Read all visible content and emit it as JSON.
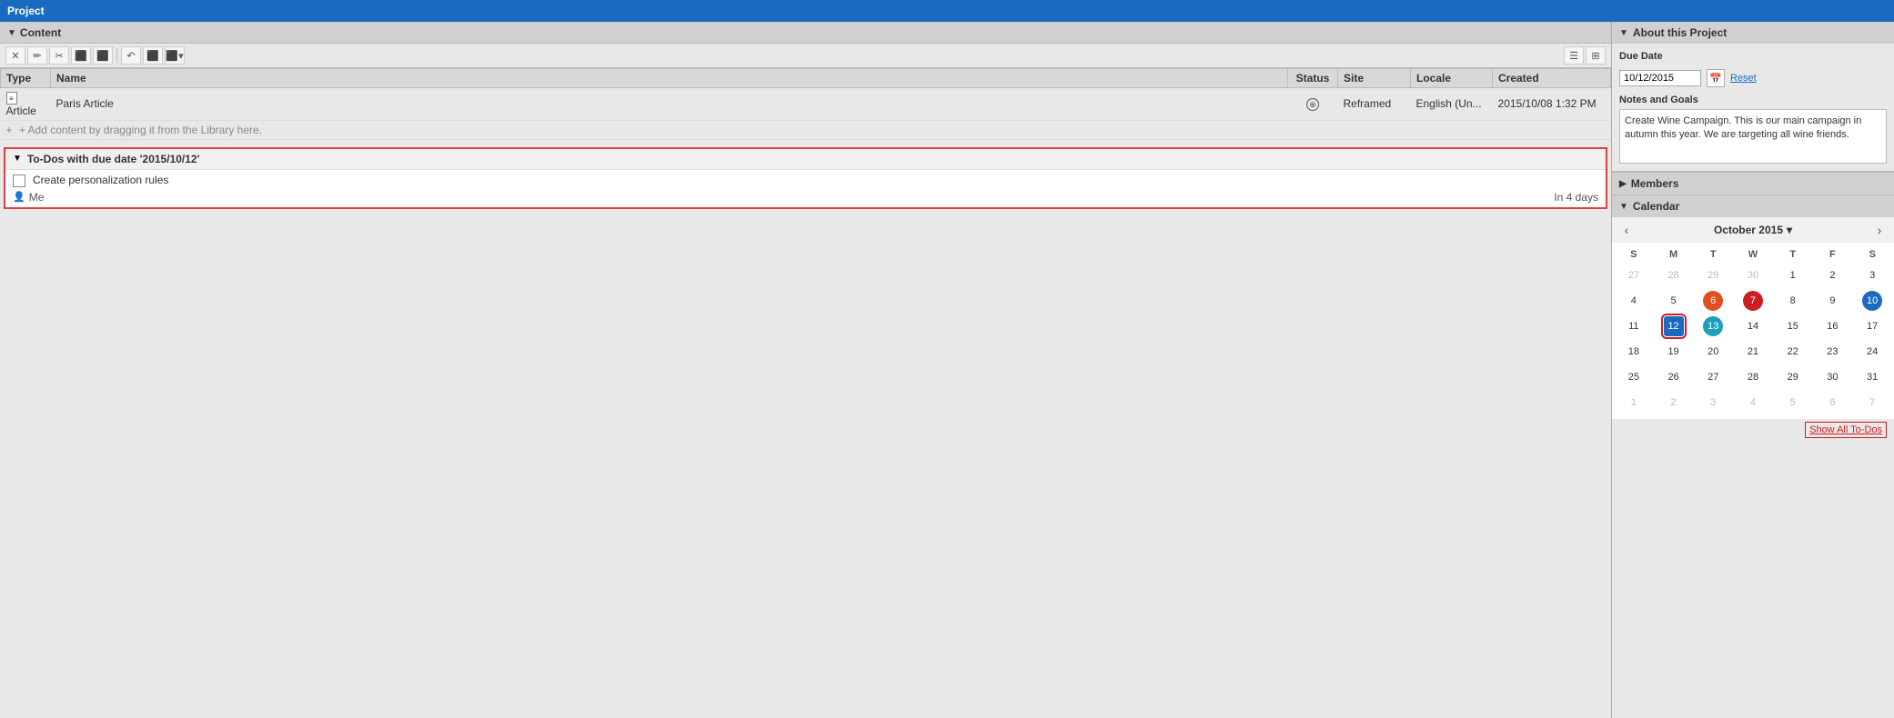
{
  "titleBar": {
    "label": "Project"
  },
  "toolbar": {
    "buttons": [
      "✕",
      "✏",
      "✂",
      "⬛",
      "⬛",
      "↶",
      "⬛",
      "⬛"
    ],
    "viewIcons": [
      "☰",
      "⊞"
    ]
  },
  "contentSection": {
    "toggle": "▼",
    "label": "Content",
    "table": {
      "columns": [
        "Type",
        "Name",
        "Status",
        "Site",
        "Locale",
        "Created"
      ],
      "rows": [
        {
          "type": "Article",
          "name": "Paris Article",
          "status": "globe",
          "site": "Reframed",
          "locale": "English (Un...",
          "created": "2015/10/08 1:32 PM"
        }
      ],
      "addRow": "+ Add content by dragging it from the Library here."
    }
  },
  "todoSection": {
    "toggle": "▼",
    "label": "To-Dos with due date '2015/10/12'",
    "items": [
      {
        "checked": false,
        "label": "Create personalization rules",
        "assignee": "Me",
        "daysLabel": "In 4 days"
      }
    ]
  },
  "rightPanel": {
    "aboutProject": {
      "sectionLabel": "About this Project",
      "dueDateLabel": "Due Date",
      "dueDateValue": "10/12/2015",
      "resetLabel": "Reset",
      "notesLabel": "Notes and Goals",
      "notesText": "Create Wine Campaign. This is our main campaign in autumn this year. We are targeting all wine friends."
    },
    "members": {
      "sectionLabel": "Members",
      "toggle": "▶"
    },
    "calendar": {
      "sectionLabel": "Calendar",
      "toggle": "▼",
      "monthYear": "October 2015",
      "prevBtn": "‹",
      "nextBtn": "›",
      "dropdownIcon": "▾",
      "dayHeaders": [
        "S",
        "M",
        "T",
        "W",
        "T",
        "F",
        "S"
      ],
      "weeks": [
        [
          {
            "day": "27",
            "other": true,
            "style": ""
          },
          {
            "day": "28",
            "other": true,
            "style": ""
          },
          {
            "day": "29",
            "other": true,
            "style": ""
          },
          {
            "day": "30",
            "other": true,
            "style": ""
          },
          {
            "day": "1",
            "other": false,
            "style": ""
          },
          {
            "day": "2",
            "other": false,
            "style": ""
          },
          {
            "day": "3",
            "other": false,
            "style": ""
          }
        ],
        [
          {
            "day": "4",
            "other": false,
            "style": ""
          },
          {
            "day": "5",
            "other": false,
            "style": ""
          },
          {
            "day": "6",
            "other": false,
            "style": "dot-orange"
          },
          {
            "day": "7",
            "other": false,
            "style": "dot-red"
          },
          {
            "day": "8",
            "other": false,
            "style": ""
          },
          {
            "day": "9",
            "other": false,
            "style": ""
          },
          {
            "day": "10",
            "other": false,
            "style": "sat-blue"
          }
        ],
        [
          {
            "day": "11",
            "other": false,
            "style": ""
          },
          {
            "day": "12",
            "other": false,
            "style": "today-box"
          },
          {
            "day": "13",
            "other": false,
            "style": "dot-teal"
          },
          {
            "day": "14",
            "other": false,
            "style": ""
          },
          {
            "day": "15",
            "other": false,
            "style": ""
          },
          {
            "day": "16",
            "other": false,
            "style": ""
          },
          {
            "day": "17",
            "other": false,
            "style": ""
          }
        ],
        [
          {
            "day": "18",
            "other": false,
            "style": ""
          },
          {
            "day": "19",
            "other": false,
            "style": ""
          },
          {
            "day": "20",
            "other": false,
            "style": ""
          },
          {
            "day": "21",
            "other": false,
            "style": ""
          },
          {
            "day": "22",
            "other": false,
            "style": ""
          },
          {
            "day": "23",
            "other": false,
            "style": ""
          },
          {
            "day": "24",
            "other": false,
            "style": ""
          }
        ],
        [
          {
            "day": "25",
            "other": false,
            "style": ""
          },
          {
            "day": "26",
            "other": false,
            "style": ""
          },
          {
            "day": "27",
            "other": false,
            "style": ""
          },
          {
            "day": "28",
            "other": false,
            "style": ""
          },
          {
            "day": "29",
            "other": false,
            "style": ""
          },
          {
            "day": "30",
            "other": false,
            "style": ""
          },
          {
            "day": "31",
            "other": false,
            "style": ""
          }
        ],
        [
          {
            "day": "1",
            "other": true,
            "style": ""
          },
          {
            "day": "2",
            "other": true,
            "style": ""
          },
          {
            "day": "3",
            "other": true,
            "style": ""
          },
          {
            "day": "4",
            "other": true,
            "style": ""
          },
          {
            "day": "5",
            "other": true,
            "style": ""
          },
          {
            "day": "6",
            "other": true,
            "style": ""
          },
          {
            "day": "7",
            "other": true,
            "style": ""
          }
        ]
      ],
      "showAllLabel": "Show All To-Dos"
    }
  }
}
